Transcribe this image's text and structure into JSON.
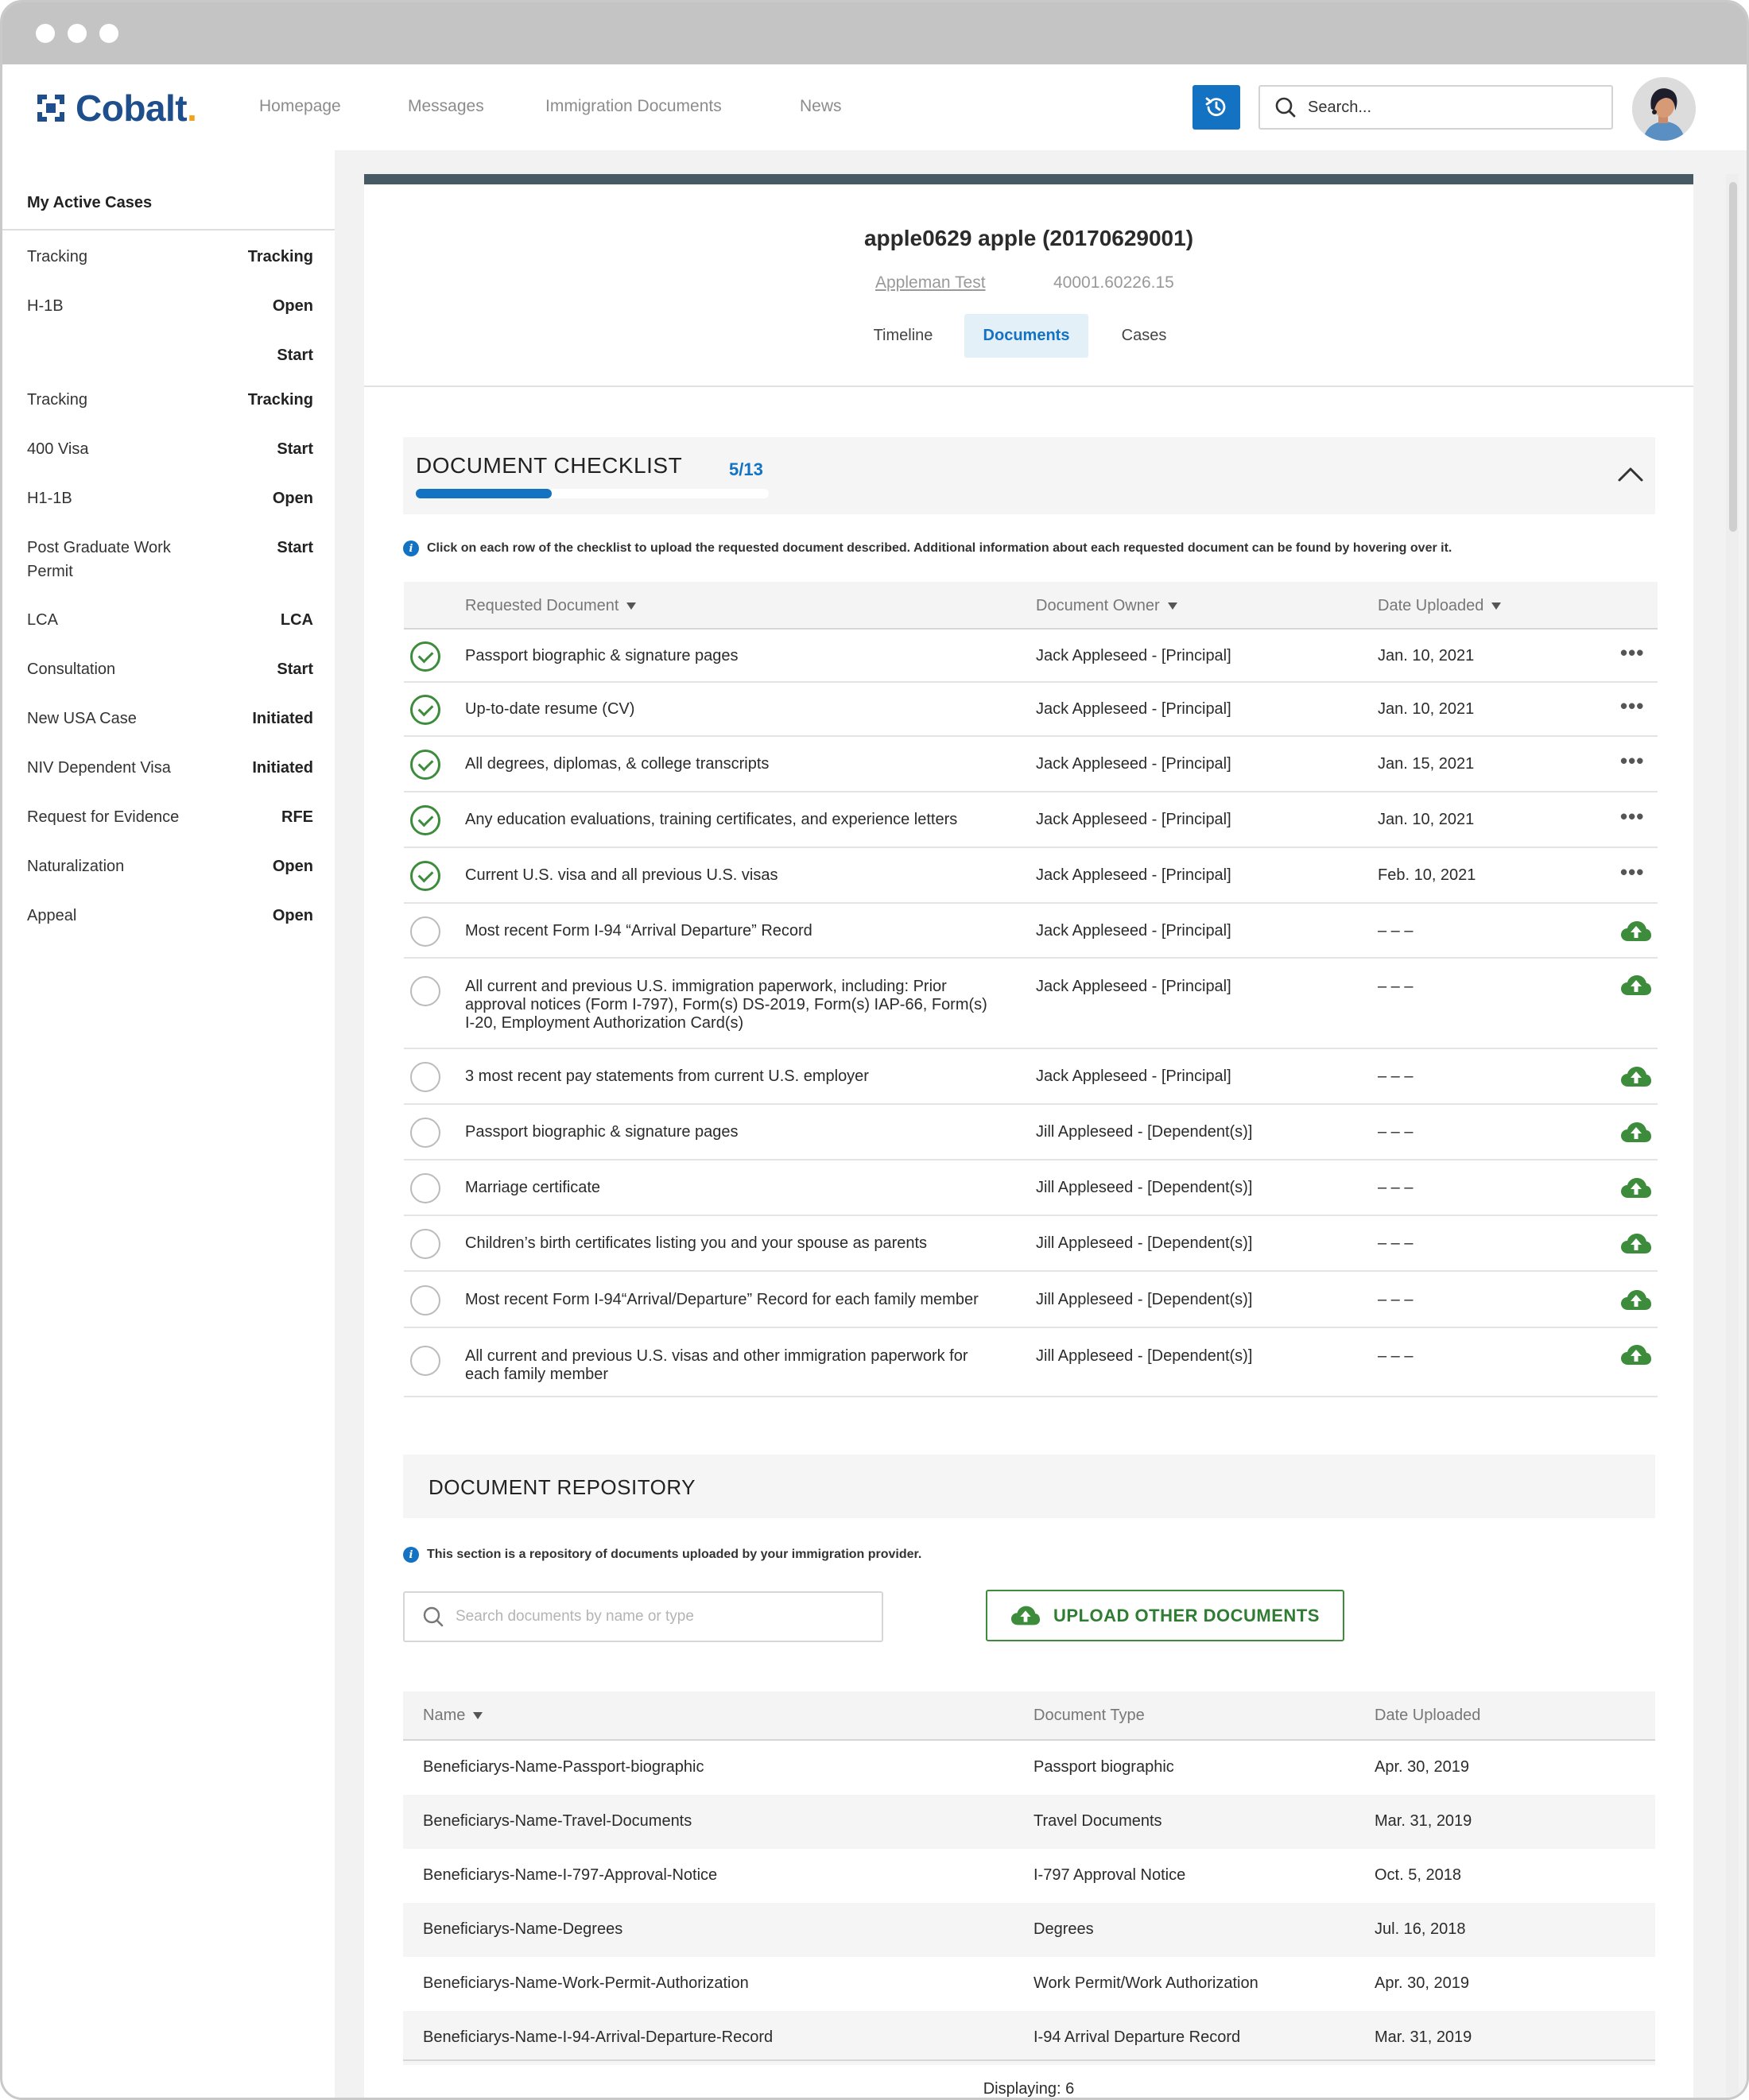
{
  "brand": {
    "name": "Cobalt",
    "dot": "."
  },
  "nav": {
    "links": [
      "Homepage",
      "Messages",
      "Immigration Documents",
      "News"
    ],
    "search_placeholder": "Search..."
  },
  "sidebar": {
    "title": "My Active Cases",
    "items": [
      {
        "label": "Tracking",
        "status": "Tracking"
      },
      {
        "label": "H-1B",
        "status": "Open"
      },
      {
        "label": "",
        "status": "Start"
      },
      {
        "label": "Tracking",
        "status": "Tracking"
      },
      {
        "label": "400 Visa",
        "status": "Start"
      },
      {
        "label": "H1-1B",
        "status": "Open"
      },
      {
        "label": "Post Graduate Work Permit",
        "status": "Start"
      },
      {
        "label": "LCA",
        "status": "LCA"
      },
      {
        "label": "Consultation",
        "status": "Start"
      },
      {
        "label": "New USA Case",
        "status": "Initiated"
      },
      {
        "label": "NIV Dependent Visa",
        "status": "Initiated"
      },
      {
        "label": "Request for Evidence",
        "status": "RFE"
      },
      {
        "label": "Naturalization",
        "status": "Open"
      },
      {
        "label": "Appeal",
        "status": "Open"
      }
    ]
  },
  "case": {
    "title": "apple0629 apple (20170629001)",
    "link": "Appleman Test",
    "number": "40001.60226.15",
    "tabs": [
      "Timeline",
      "Documents",
      "Cases"
    ],
    "active_tab": "Documents"
  },
  "checklist": {
    "title": "DOCUMENT CHECKLIST",
    "count": "5/13",
    "progress_fraction": 0.3846,
    "info": "Click on each row of the checklist to upload the requested document described. Additional information about each requested document can be found by hovering over it.",
    "headers": [
      "Requested Document",
      "Document Owner",
      "Date Uploaded"
    ],
    "rows": [
      {
        "done": true,
        "doc": "Passport biographic & signature pages",
        "owner": "Jack Appleseed - [Principal]",
        "date": "Jan. 10, 2021"
      },
      {
        "done": true,
        "doc": "Up-to-date resume (CV)",
        "owner": "Jack Appleseed - [Principal]",
        "date": "Jan. 10, 2021"
      },
      {
        "done": true,
        "doc": "All degrees, diplomas, & college transcripts",
        "owner": "Jack Appleseed - [Principal]",
        "date": "Jan. 15, 2021"
      },
      {
        "done": true,
        "doc": "Any education evaluations, training certificates, and experience letters",
        "owner": "Jack Appleseed - [Principal]",
        "date": "Jan. 10, 2021"
      },
      {
        "done": true,
        "doc": "Current U.S. visa and all previous U.S. visas",
        "owner": "Jack Appleseed - [Principal]",
        "date": "Feb. 10, 2021"
      },
      {
        "done": false,
        "doc": "Most recent Form I-94 “Arrival Departure” Record",
        "owner": "Jack Appleseed - [Principal]",
        "date": "– – –"
      },
      {
        "done": false,
        "doc": "All current and previous U.S. immigration paperwork, including: Prior approval notices (Form I-797), Form(s) DS-2019, Form(s) IAP-66, Form(s) I-20, Employment Authorization Card(s)",
        "owner": "Jack Appleseed - [Principal]",
        "date": "– – –"
      },
      {
        "done": false,
        "doc": "3 most recent pay statements from current U.S. employer",
        "owner": "Jack Appleseed - [Principal]",
        "date": "– – –"
      },
      {
        "done": false,
        "doc": "Passport biographic & signature pages",
        "owner": "Jill Appleseed - [Dependent(s)]",
        "date": "– – –"
      },
      {
        "done": false,
        "doc": "Marriage certificate",
        "owner": "Jill Appleseed - [Dependent(s)]",
        "date": "– – –"
      },
      {
        "done": false,
        "doc": "Children’s birth certificates listing you and your spouse as parents",
        "owner": "Jill Appleseed - [Dependent(s)]",
        "date": "– – –"
      },
      {
        "done": false,
        "doc": "Most recent Form I-94“Arrival/Departure” Record for each family member",
        "owner": "Jill Appleseed - [Dependent(s)]",
        "date": "– – –"
      },
      {
        "done": false,
        "doc": "All current and previous U.S. visas and other immigration paperwork for each family member",
        "owner": "Jill Appleseed - [Dependent(s)]",
        "date": "– – –"
      }
    ]
  },
  "repository": {
    "title": "DOCUMENT REPOSITORY",
    "info": "This section is a repository of documents uploaded by your immigration provider.",
    "search_placeholder": "Search documents by name or type",
    "upload_label": "UPLOAD OTHER DOCUMENTS",
    "headers": [
      "Name",
      "Document Type",
      "Date Uploaded"
    ],
    "rows": [
      {
        "name": "Beneficiarys-Name-Passport-biographic",
        "type": "Passport biographic",
        "date": "Apr. 30, 2019"
      },
      {
        "name": "Beneficiarys-Name-Travel-Documents",
        "type": "Travel Documents",
        "date": "Mar. 31, 2019"
      },
      {
        "name": "Beneficiarys-Name-I-797-Approval-Notice",
        "type": "I-797 Approval Notice",
        "date": "Oct. 5, 2018"
      },
      {
        "name": "Beneficiarys-Name-Degrees",
        "type": "Degrees",
        "date": "Jul. 16, 2018"
      },
      {
        "name": "Beneficiarys-Name-Work-Permit-Authorization",
        "type": "Work Permit/Work Authorization",
        "date": "Apr. 30, 2019"
      },
      {
        "name": "Beneficiarys-Name-I-94-Arrival-Departure-Record",
        "type": "I-94 Arrival Departure Record",
        "date": "Mar. 31, 2019"
      }
    ],
    "displaying": "Displaying: 6"
  },
  "colors": {
    "accent": "#1372c2",
    "brand": "#1f4e8c",
    "success": "#3c8c3c",
    "header_bar": "#475963"
  }
}
